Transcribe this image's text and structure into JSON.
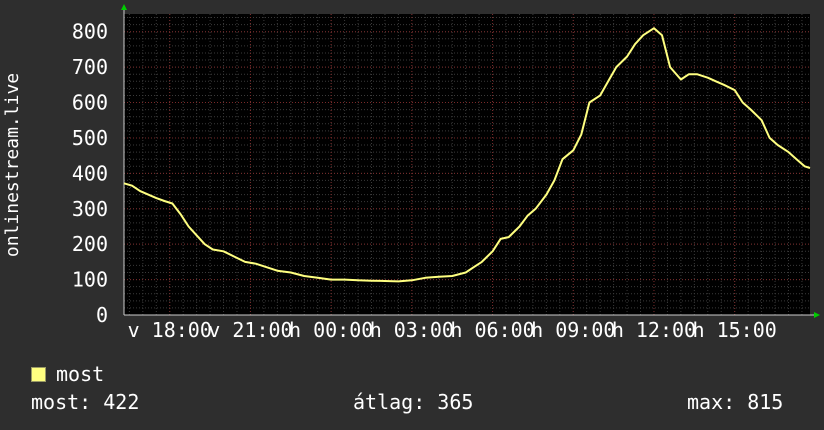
{
  "chart_data": {
    "type": "line",
    "ylabel": "onlinestream.live",
    "ylim": [
      0,
      850
    ],
    "yticks": [
      0,
      100,
      200,
      300,
      400,
      500,
      600,
      700,
      800
    ],
    "x_tick_labels": [
      "v 18:00",
      "v 21:00",
      "h 00:00",
      "h 03:00",
      "h 06:00",
      "h 09:00",
      "h 12:00",
      "h 15:00"
    ],
    "x_tick_hours": [
      18,
      21,
      24,
      27,
      30,
      33,
      36,
      39
    ],
    "x_range_hours": [
      16.3,
      41.8
    ],
    "grid": true,
    "legend_position": "bottom-left",
    "series": [
      {
        "name": "most",
        "color": "#ffff80",
        "x": [
          16.3,
          16.6,
          16.9,
          17.2,
          17.5,
          17.8,
          18.1,
          18.4,
          18.7,
          19.0,
          19.3,
          19.6,
          20.0,
          20.4,
          20.8,
          21.2,
          21.6,
          22.0,
          22.5,
          23.0,
          23.5,
          24.0,
          24.5,
          25.0,
          25.5,
          26.0,
          26.5,
          27.0,
          27.5,
          28.0,
          28.5,
          29.0,
          29.3,
          29.6,
          30.0,
          30.3,
          30.6,
          31.0,
          31.3,
          31.6,
          32.0,
          32.3,
          32.6,
          33.0,
          33.3,
          33.6,
          34.0,
          34.3,
          34.6,
          35.0,
          35.3,
          35.6,
          35.8,
          36.0,
          36.3,
          36.6,
          37.0,
          37.3,
          37.6,
          38.0,
          38.3,
          38.6,
          39.0,
          39.3,
          39.6,
          40.0,
          40.3,
          40.6,
          41.0,
          41.3,
          41.6,
          41.8
        ],
        "y": [
          372,
          365,
          350,
          340,
          330,
          322,
          315,
          285,
          250,
          225,
          200,
          185,
          180,
          165,
          150,
          145,
          135,
          125,
          120,
          110,
          105,
          100,
          100,
          98,
          97,
          96,
          95,
          98,
          105,
          108,
          110,
          120,
          135,
          150,
          180,
          215,
          220,
          250,
          280,
          300,
          340,
          380,
          440,
          465,
          510,
          600,
          620,
          660,
          700,
          730,
          765,
          790,
          800,
          810,
          790,
          700,
          665,
          680,
          680,
          670,
          660,
          650,
          635,
          600,
          580,
          550,
          500,
          480,
          460,
          440,
          420,
          415
        ]
      }
    ]
  },
  "stats": {
    "now": "most: 422",
    "avg": "átlag: 365",
    "max": "max: 815"
  }
}
